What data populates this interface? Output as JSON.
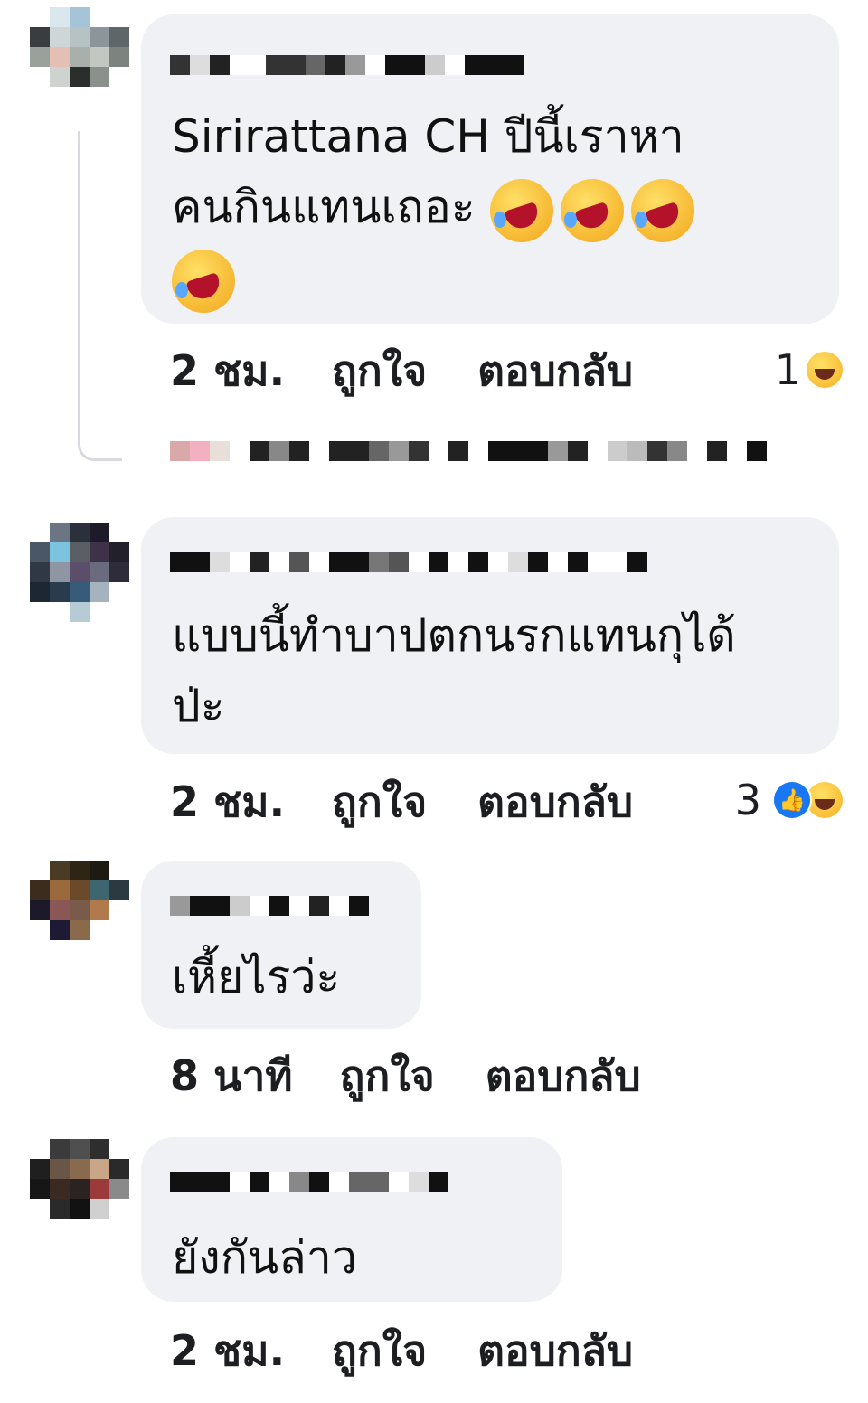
{
  "comments": [
    {
      "text": "Sirirattana CH ปีนี้เราหา\nคนกินแทนเถอะ",
      "time": "2 ชม.",
      "like": "ถูกใจ",
      "reply": "ตอบกลับ",
      "reaction_count": "1",
      "reactions": [
        "haha-icon"
      ],
      "emojis": [
        "rolling-laughing-icon",
        "rolling-laughing-icon",
        "rolling-laughing-icon",
        "rolling-laughing-icon"
      ]
    },
    {
      "text": "แบบนี้ทำบาปตกนรกแทนกุได้\nป่ะ",
      "time": "2 ชม.",
      "like": "ถูกใจ",
      "reply": "ตอบกลับ",
      "reaction_count": "3",
      "reactions": [
        "like-icon",
        "haha-icon"
      ]
    },
    {
      "text": "เหี้ยไรว่ะ",
      "time": "8 นาที",
      "like": "ถูกใจ",
      "reply": "ตอบกลับ"
    },
    {
      "text": "ยังกันล่าว",
      "time": "2 ชม.",
      "like": "ถูกใจ",
      "reply": "ตอบกลับ"
    }
  ],
  "colors": {
    "bubble": "#eff1f5",
    "like_blue": "#1877f2",
    "haha_yellow": "#f7b125",
    "text": "#1c1e21"
  }
}
